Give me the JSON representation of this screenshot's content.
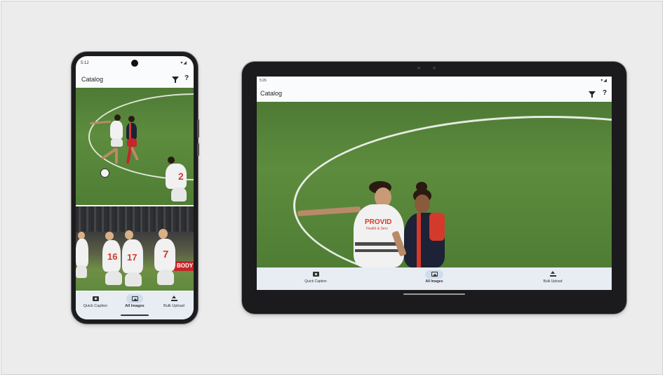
{
  "phone": {
    "status": {
      "time": "5:12",
      "icons": "▾◢"
    },
    "appbar": {
      "title": "Catalog",
      "filter_icon": "filter-icon",
      "help_icon": "?"
    },
    "nav": [
      {
        "label": "Quick Caption",
        "icon": "camera-icon",
        "selected": false
      },
      {
        "label": "All Images",
        "icon": "image-icon",
        "selected": true
      },
      {
        "label": "Bulk Upload",
        "icon": "upload-icon",
        "selected": false
      }
    ],
    "photos": [
      {
        "numbers": [
          "2"
        ]
      },
      {
        "numbers": [
          "16",
          "17",
          "7"
        ],
        "banner": "BODY"
      }
    ]
  },
  "tablet": {
    "status": {
      "time": "5:26",
      "icons": "▾◢"
    },
    "appbar": {
      "title": "Catalog",
      "filter_icon": "filter-icon",
      "help_icon": "?"
    },
    "nav": [
      {
        "label": "Quick Caption",
        "icon": "camera-icon",
        "selected": false
      },
      {
        "label": "All Images",
        "icon": "image-icon",
        "selected": true
      },
      {
        "label": "Bulk Upload",
        "icon": "upload-icon",
        "selected": false
      }
    ],
    "photo": {
      "jersey_text": "PROVID",
      "jersey_sub": "Health & Serv"
    }
  },
  "colors": {
    "pitch": "#5d8c3e",
    "nav_bg": "#e8edf3",
    "selected_pill": "#cfdceb",
    "kit_red": "#d33a2c"
  }
}
